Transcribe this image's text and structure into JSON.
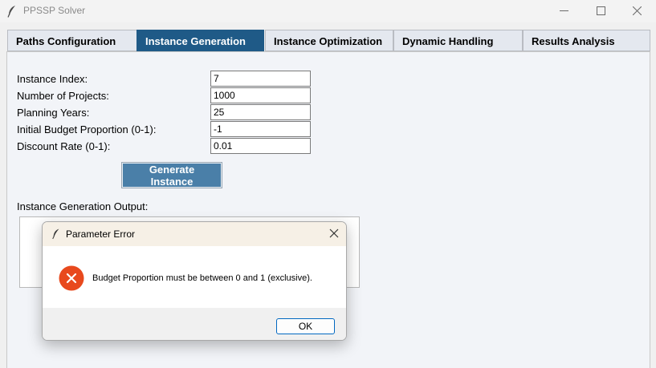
{
  "window": {
    "title": "PPSSP Solver",
    "app_icon": "feather-icon",
    "controls": [
      "minimize-icon",
      "maximize-icon",
      "close-icon"
    ]
  },
  "tabs": [
    {
      "label": "Paths Configuration",
      "active": false
    },
    {
      "label": "Instance Generation",
      "active": true
    },
    {
      "label": "Instance Optimization",
      "active": false
    },
    {
      "label": "Dynamic Handling",
      "active": false
    },
    {
      "label": "Results Analysis",
      "active": false
    }
  ],
  "form": {
    "instance_index": {
      "label": "Instance Index:",
      "value": "7"
    },
    "num_projects": {
      "label": "Number of Projects:",
      "value": "1000"
    },
    "planning_years": {
      "label": "Planning Years:",
      "value": "25"
    },
    "budget_proportion": {
      "label": "Initial Budget Proportion (0-1):",
      "value": "-1"
    },
    "discount_rate": {
      "label": "Discount Rate (0-1):",
      "value": "0.01"
    }
  },
  "generate_button": "Generate Instance",
  "output_label": "Instance Generation Output:",
  "dialog": {
    "title": "Parameter Error",
    "message": "Budget Proportion must be between 0 and 1 (exclusive).",
    "ok_label": "OK",
    "icon": "error-icon"
  },
  "colors": {
    "active_tab": "#1f5a87",
    "button": "#4a7fa8",
    "error": "#e8491d",
    "ok_border": "#0067c0"
  }
}
